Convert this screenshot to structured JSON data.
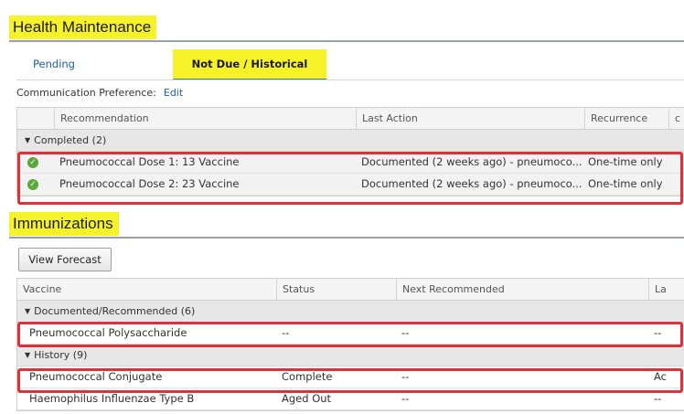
{
  "health_maintenance": {
    "title": "Health Maintenance",
    "tabs": {
      "pending": "Pending",
      "active": "Not Due / Historical"
    },
    "communication": {
      "label": "Communication Preference:",
      "edit": "Edit"
    },
    "columns": [
      "Recommendation",
      "Last Action",
      "Recurrence",
      "c"
    ],
    "group": {
      "label": "Completed (2)"
    },
    "rows": [
      {
        "recommendation": "Pneumococcal Dose 1: 13 Vaccine",
        "last_action": "Documented (2 weeks ago) - pneumoco...",
        "recurrence": "One-time only",
        "status_icon": "check-circle-icon"
      },
      {
        "recommendation": "Pneumococcal Dose 2: 23 Vaccine",
        "last_action": "Documented (2 weeks ago) - pneumoco...",
        "recurrence": "One-time only",
        "status_icon": "check-circle-icon"
      }
    ]
  },
  "immunizations": {
    "title": "Immunizations",
    "view_forecast": "View Forecast",
    "columns": [
      "Vaccine",
      "Status",
      "Next Recommended",
      "La"
    ],
    "groups": [
      {
        "label": "Documented/Recommended (6)"
      },
      {
        "label": "History (9)"
      }
    ],
    "documented_rows": [
      {
        "vaccine": "Pneumococcal Polysaccharide",
        "status": "--",
        "next": "--",
        "last": "--"
      }
    ],
    "history_rows": [
      {
        "vaccine": "Pneumococcal Conjugate",
        "status": "Complete",
        "next": "--",
        "last": "Ac"
      },
      {
        "vaccine": "Haemophilus Influenzae Type B",
        "status": "Aged Out",
        "next": "--",
        "last": "--"
      }
    ]
  },
  "colors": {
    "highlight_yellow": "#f6f22a",
    "annotation_red": "#e0303a",
    "link_blue": "#1f5fa8",
    "check_green": "#5aa83a"
  }
}
